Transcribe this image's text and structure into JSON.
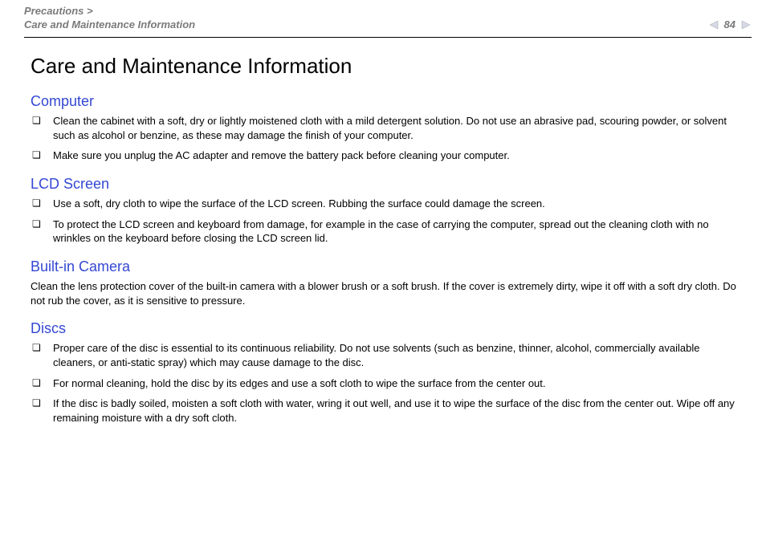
{
  "header": {
    "breadcrumb_line1": "Precautions >",
    "breadcrumb_line2": "Care and Maintenance Information",
    "page_number": "84",
    "nav_n_label": "n",
    "nav_N_label": "N"
  },
  "title": "Care and Maintenance Information",
  "sections": {
    "computer": {
      "heading": "Computer",
      "items": [
        "Clean the cabinet with a soft, dry or lightly moistened cloth with a mild detergent solution. Do not use an abrasive pad, scouring powder, or solvent such as alcohol or benzine, as these may damage the finish of your computer.",
        "Make sure you unplug the AC adapter and remove the battery pack before cleaning your computer."
      ]
    },
    "lcd": {
      "heading": "LCD Screen",
      "items": [
        "Use a soft, dry cloth to wipe the surface of the LCD screen. Rubbing the surface could damage the screen.",
        "To protect the LCD screen and keyboard from damage, for example in the case of carrying the computer, spread out the cleaning cloth with no wrinkles on the keyboard before closing the LCD screen lid."
      ]
    },
    "camera": {
      "heading": "Built-in Camera",
      "text": "Clean the lens protection cover of the built-in camera with a blower brush or a soft brush. If the cover is extremely dirty, wipe it off with a soft dry cloth. Do not rub the cover, as it is sensitive to pressure."
    },
    "discs": {
      "heading": "Discs",
      "items": [
        "Proper care of the disc is essential to its continuous reliability. Do not use solvents (such as benzine, thinner, alcohol, commercially available cleaners, or anti-static spray) which may cause damage to the disc.",
        "For normal cleaning, hold the disc by its edges and use a soft cloth to wipe the surface from the center out.",
        "If the disc is badly soiled, moisten a soft cloth with water, wring it out well, and use it to wipe the surface of the disc from the center out. Wipe off any remaining moisture with a dry soft cloth."
      ]
    }
  }
}
